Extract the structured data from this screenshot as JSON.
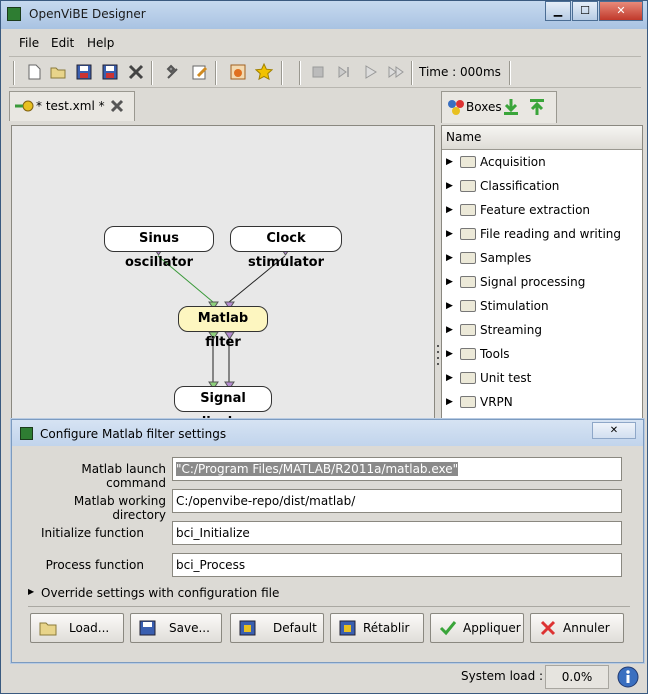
{
  "window": {
    "title": "OpenViBE Designer",
    "min": "▁",
    "max": "☐",
    "close": "✕"
  },
  "menu": {
    "file": "File",
    "edit": "Edit",
    "help": "Help"
  },
  "toolbar": {
    "time_label": "Time : 000ms"
  },
  "tab": {
    "label": "* test.xml *"
  },
  "canvas": {
    "boxes": [
      "Sinus oscillator",
      "Clock stimulator",
      "Matlab filter",
      "Signal display"
    ]
  },
  "boxes_panel": {
    "tab_label": "Boxes",
    "header": "Name",
    "items": [
      "Acquisition",
      "Classification",
      "Feature extraction",
      "File reading and writing",
      "Samples",
      "Signal processing",
      "Stimulation",
      "Streaming",
      "Tools",
      "Unit test",
      "VRPN"
    ]
  },
  "status": {
    "label": "System load :",
    "value": "0.0%"
  },
  "dialog": {
    "title": "Configure Matlab filter settings",
    "fields": [
      {
        "label": "Matlab launch command",
        "value": "\"C:/Program Files/MATLAB/R2011a/matlab.exe\""
      },
      {
        "label": "Matlab working directory",
        "value": "C:/openvibe-repo/dist/matlab/"
      },
      {
        "label": "Initialize function",
        "value": "bci_Initialize"
      },
      {
        "label": "Process function",
        "value": "bci_Process"
      }
    ],
    "override": "Override settings with configuration file",
    "buttons": {
      "load": "Load...",
      "save": "Save...",
      "default": "Default",
      "reset": "Rétablir",
      "apply": "Appliquer",
      "cancel": "Annuler"
    }
  },
  "colors": {
    "selected_box": "#fdf6c0",
    "apply_check": "#3aa53a",
    "cancel_x": "#d33"
  }
}
